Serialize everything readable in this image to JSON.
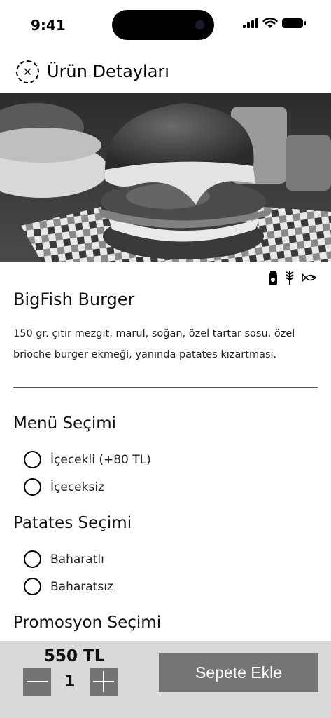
{
  "status_bar": {
    "time": "9:41"
  },
  "header": {
    "title": "Ürün Detayları",
    "close_icon": "close-icon"
  },
  "hero": {
    "icon": "burger-photo"
  },
  "allergens": [
    "jar-icon",
    "wheat-icon",
    "fish-icon"
  ],
  "product": {
    "name": "BigFish Burger",
    "description": "150 gr. çıtır mezgit, marul, soğan, özel tartar sosu, özel brioche burger ekmeği, yanında patates kızartması."
  },
  "sections": {
    "menu": {
      "title": "Menü Seçimi",
      "options": [
        "İçecekli (+80 TL)",
        "İçeceksiz"
      ]
    },
    "fries": {
      "title": "Patates Seçimi",
      "options": [
        "Baharatlı",
        "Baharatsız"
      ]
    },
    "promo": {
      "title": "Promosyon Seçimi"
    }
  },
  "cart": {
    "price": "550 TL",
    "quantity": "1",
    "add_label": "Sepete Ekle"
  }
}
